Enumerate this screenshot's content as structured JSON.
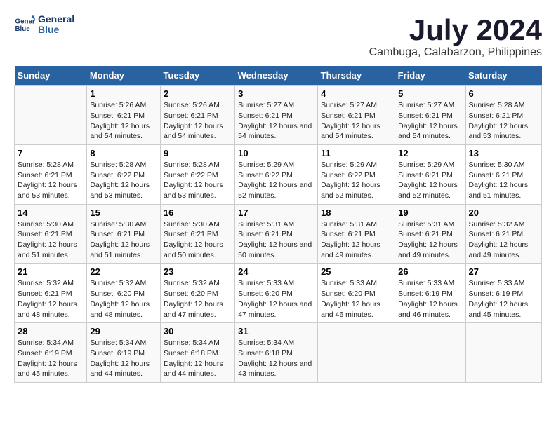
{
  "header": {
    "logo_line1": "General",
    "logo_line2": "Blue",
    "main_title": "July 2024",
    "subtitle": "Cambuga, Calabarzon, Philippines"
  },
  "calendar": {
    "days_of_week": [
      "Sunday",
      "Monday",
      "Tuesday",
      "Wednesday",
      "Thursday",
      "Friday",
      "Saturday"
    ],
    "weeks": [
      [
        {
          "day": "",
          "info": ""
        },
        {
          "day": "1",
          "info": "Sunrise: 5:26 AM\nSunset: 6:21 PM\nDaylight: 12 hours and 54 minutes."
        },
        {
          "day": "2",
          "info": "Sunrise: 5:26 AM\nSunset: 6:21 PM\nDaylight: 12 hours and 54 minutes."
        },
        {
          "day": "3",
          "info": "Sunrise: 5:27 AM\nSunset: 6:21 PM\nDaylight: 12 hours and 54 minutes."
        },
        {
          "day": "4",
          "info": "Sunrise: 5:27 AM\nSunset: 6:21 PM\nDaylight: 12 hours and 54 minutes."
        },
        {
          "day": "5",
          "info": "Sunrise: 5:27 AM\nSunset: 6:21 PM\nDaylight: 12 hours and 54 minutes."
        },
        {
          "day": "6",
          "info": "Sunrise: 5:28 AM\nSunset: 6:21 PM\nDaylight: 12 hours and 53 minutes."
        }
      ],
      [
        {
          "day": "7",
          "info": "Sunrise: 5:28 AM\nSunset: 6:21 PM\nDaylight: 12 hours and 53 minutes."
        },
        {
          "day": "8",
          "info": "Sunrise: 5:28 AM\nSunset: 6:22 PM\nDaylight: 12 hours and 53 minutes."
        },
        {
          "day": "9",
          "info": "Sunrise: 5:28 AM\nSunset: 6:22 PM\nDaylight: 12 hours and 53 minutes."
        },
        {
          "day": "10",
          "info": "Sunrise: 5:29 AM\nSunset: 6:22 PM\nDaylight: 12 hours and 52 minutes."
        },
        {
          "day": "11",
          "info": "Sunrise: 5:29 AM\nSunset: 6:22 PM\nDaylight: 12 hours and 52 minutes."
        },
        {
          "day": "12",
          "info": "Sunrise: 5:29 AM\nSunset: 6:21 PM\nDaylight: 12 hours and 52 minutes."
        },
        {
          "day": "13",
          "info": "Sunrise: 5:30 AM\nSunset: 6:21 PM\nDaylight: 12 hours and 51 minutes."
        }
      ],
      [
        {
          "day": "14",
          "info": "Sunrise: 5:30 AM\nSunset: 6:21 PM\nDaylight: 12 hours and 51 minutes."
        },
        {
          "day": "15",
          "info": "Sunrise: 5:30 AM\nSunset: 6:21 PM\nDaylight: 12 hours and 51 minutes."
        },
        {
          "day": "16",
          "info": "Sunrise: 5:30 AM\nSunset: 6:21 PM\nDaylight: 12 hours and 50 minutes."
        },
        {
          "day": "17",
          "info": "Sunrise: 5:31 AM\nSunset: 6:21 PM\nDaylight: 12 hours and 50 minutes."
        },
        {
          "day": "18",
          "info": "Sunrise: 5:31 AM\nSunset: 6:21 PM\nDaylight: 12 hours and 49 minutes."
        },
        {
          "day": "19",
          "info": "Sunrise: 5:31 AM\nSunset: 6:21 PM\nDaylight: 12 hours and 49 minutes."
        },
        {
          "day": "20",
          "info": "Sunrise: 5:32 AM\nSunset: 6:21 PM\nDaylight: 12 hours and 49 minutes."
        }
      ],
      [
        {
          "day": "21",
          "info": "Sunrise: 5:32 AM\nSunset: 6:21 PM\nDaylight: 12 hours and 48 minutes."
        },
        {
          "day": "22",
          "info": "Sunrise: 5:32 AM\nSunset: 6:20 PM\nDaylight: 12 hours and 48 minutes."
        },
        {
          "day": "23",
          "info": "Sunrise: 5:32 AM\nSunset: 6:20 PM\nDaylight: 12 hours and 47 minutes."
        },
        {
          "day": "24",
          "info": "Sunrise: 5:33 AM\nSunset: 6:20 PM\nDaylight: 12 hours and 47 minutes."
        },
        {
          "day": "25",
          "info": "Sunrise: 5:33 AM\nSunset: 6:20 PM\nDaylight: 12 hours and 46 minutes."
        },
        {
          "day": "26",
          "info": "Sunrise: 5:33 AM\nSunset: 6:19 PM\nDaylight: 12 hours and 46 minutes."
        },
        {
          "day": "27",
          "info": "Sunrise: 5:33 AM\nSunset: 6:19 PM\nDaylight: 12 hours and 45 minutes."
        }
      ],
      [
        {
          "day": "28",
          "info": "Sunrise: 5:34 AM\nSunset: 6:19 PM\nDaylight: 12 hours and 45 minutes."
        },
        {
          "day": "29",
          "info": "Sunrise: 5:34 AM\nSunset: 6:19 PM\nDaylight: 12 hours and 44 minutes."
        },
        {
          "day": "30",
          "info": "Sunrise: 5:34 AM\nSunset: 6:18 PM\nDaylight: 12 hours and 44 minutes."
        },
        {
          "day": "31",
          "info": "Sunrise: 5:34 AM\nSunset: 6:18 PM\nDaylight: 12 hours and 43 minutes."
        },
        {
          "day": "",
          "info": ""
        },
        {
          "day": "",
          "info": ""
        },
        {
          "day": "",
          "info": ""
        }
      ]
    ]
  }
}
